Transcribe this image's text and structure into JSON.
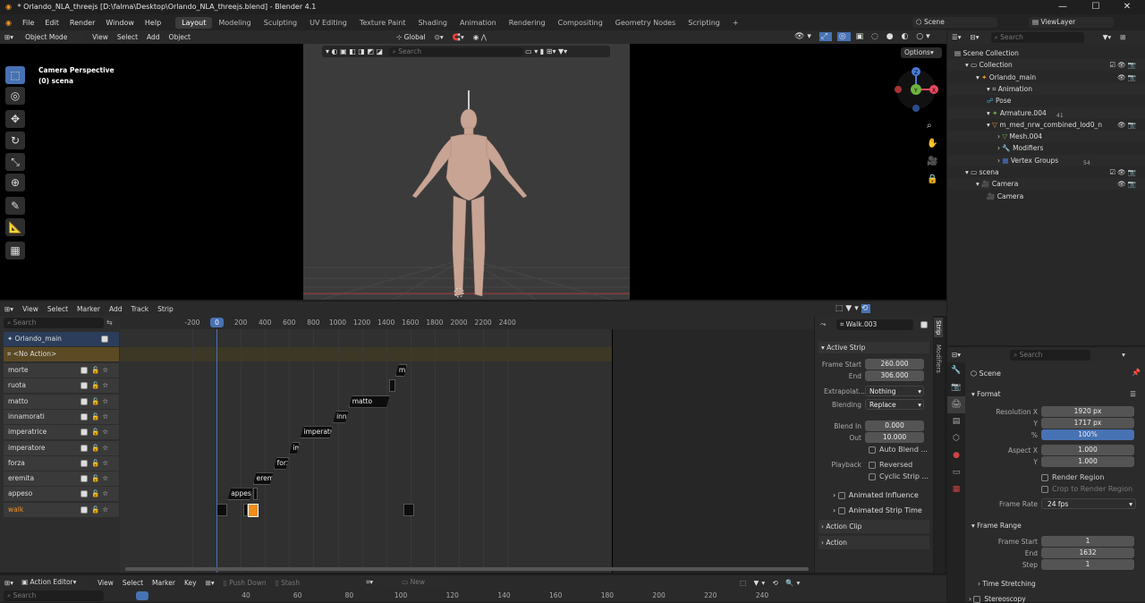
{
  "window": {
    "title": "* Orlando_NLA_threejs [D:\\falma\\Desktop\\Orlando_NLA_threejs.blend] - Blender 4.1"
  },
  "menu": [
    "File",
    "Edit",
    "Render",
    "Window",
    "Help"
  ],
  "workspaces": [
    "Layout",
    "Modeling",
    "Sculpting",
    "UV Editing",
    "Texture Paint",
    "Shading",
    "Animation",
    "Rendering",
    "Compositing",
    "Geometry Nodes",
    "Scripting"
  ],
  "add_tab": "+",
  "scene_field": "Scene",
  "viewlayer_field": "ViewLayer",
  "viewport": {
    "mode": "Object Mode",
    "menus": [
      "View",
      "Select",
      "Add",
      "Object"
    ],
    "transform": "Global",
    "overlay_title": "Camera Perspective",
    "overlay_sub": "(0) scena",
    "search_placeholder": "Search",
    "options": "Options",
    "gizmo": {
      "x": "X",
      "y": "Y",
      "z": "Z"
    }
  },
  "outliner": {
    "search_placeholder": "Search",
    "items": [
      {
        "label": "Scene Collection",
        "depth": 0
      },
      {
        "label": "Collection",
        "depth": 1
      },
      {
        "label": "Orlando_main",
        "depth": 2
      },
      {
        "label": "Animation",
        "depth": 3
      },
      {
        "label": "Pose",
        "depth": 3
      },
      {
        "label": "Armature.004",
        "depth": 3
      },
      {
        "label": "m_med_nrw_combined_lod0_n",
        "depth": 3
      },
      {
        "label": "Mesh.004",
        "depth": 4
      },
      {
        "label": "Modifiers",
        "depth": 4
      },
      {
        "label": "Vertex Groups",
        "depth": 4
      },
      {
        "label": "scena",
        "depth": 1
      },
      {
        "label": "Camera",
        "depth": 2
      },
      {
        "label": "Camera",
        "depth": 3
      }
    ],
    "badges": {
      "armature": "41",
      "vgroups": "54"
    }
  },
  "nla": {
    "menus": [
      "View",
      "Select",
      "Marker",
      "Add",
      "Track",
      "Strip"
    ],
    "search_placeholder": "Search",
    "object": "Orlando_main",
    "no_action": "<No Action>",
    "tracks": [
      "morte",
      "ruota",
      "matto",
      "innamorati",
      "imperatrice",
      "imperatore",
      "forza",
      "eremita",
      "appeso",
      "walk"
    ],
    "ruler": [
      "-200",
      "0",
      "200",
      "400",
      "600",
      "800",
      "1000",
      "1200",
      "1400",
      "1600",
      "1800",
      "2000",
      "2200",
      "2400"
    ],
    "current_frame": "0",
    "strips": [
      {
        "label": "morte"
      },
      {
        "label": "matto"
      },
      {
        "label": "innamor"
      },
      {
        "label": "imperatrice"
      },
      {
        "label": "impe"
      },
      {
        "label": "forza"
      },
      {
        "label": "eremita"
      },
      {
        "label": "appeso"
      }
    ]
  },
  "strip_panel": {
    "action_name": "Walk.003",
    "section": "Active Strip",
    "frame_start_label": "Frame Start",
    "frame_start": "260.000",
    "end_label": "End",
    "end": "306.000",
    "extrapolation_label": "Extrapolat...",
    "extrapolation": "Nothing",
    "blending_label": "Blending",
    "blending": "Replace",
    "blend_in_label": "Blend In",
    "blend_in": "0.000",
    "out_label": "Out",
    "out": "10.000",
    "auto_blend": "Auto Blend ...",
    "playback_label": "Playback",
    "reversed": "Reversed",
    "cyclic": "Cyclic Strip ...",
    "animated_influence": "Animated Influence",
    "animated_strip_time": "Animated Strip Time",
    "action_clip": "Action Clip",
    "action": "Action",
    "side_tabs": [
      "Strip",
      "Modifiers"
    ]
  },
  "properties": {
    "search_placeholder": "Search",
    "scene": "Scene",
    "format": "Format",
    "res_x_label": "Resolution X",
    "res_x": "1920 px",
    "y_label": "Y",
    "res_y": "1717 px",
    "pct_label": "%",
    "pct": "100%",
    "aspect_label": "Aspect X",
    "aspect_x": "1.000",
    "aspect_y": "1.000",
    "render_region": "Render Region",
    "crop": "Crop to Render Region",
    "frame_rate_label": "Frame Rate",
    "frame_rate": "24 fps",
    "frame_range": "Frame Range",
    "fs_label": "Frame Start",
    "fs": "1",
    "end_label": "End",
    "end": "1632",
    "step_label": "Step",
    "step": "1",
    "time_stretching": "Time Stretching",
    "stereoscopy": "Stereoscopy"
  },
  "action_editor": {
    "mode": "Action Editor",
    "menus": [
      "View",
      "Select",
      "Marker",
      "Key"
    ],
    "push_down": "Push Down",
    "stash": "Stash",
    "new": "New",
    "search_placeholder": "Search",
    "ruler": [
      "40",
      "60",
      "80",
      "100",
      "120",
      "140",
      "160",
      "180",
      "200",
      "220",
      "240"
    ]
  },
  "colors": {
    "accent": "#4772b3",
    "selected_strip": "#f08c1c"
  }
}
